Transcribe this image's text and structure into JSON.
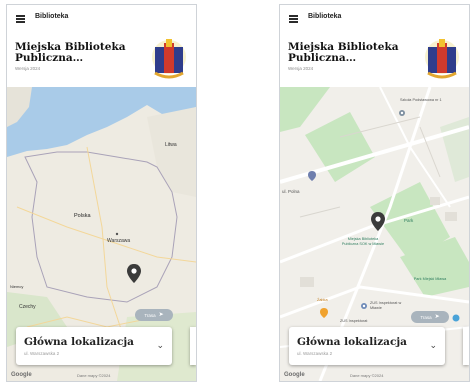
{
  "app": {
    "title": "Biblioteka",
    "library_name": "Miejska Biblioteka Publiczna…",
    "library_subtitle": "Wersja 2024"
  },
  "icons": {
    "menu": "hamburger-menu-icon",
    "logo": "library-books-logo-icon",
    "marker": "map-pin-icon",
    "chevron": "chevron-down-icon"
  },
  "left_screen": {
    "map_labels": {
      "country": "Polska",
      "city": "Warszawa",
      "neighbor_ne": "Litwa",
      "neighbor_sw": "Czechy",
      "neighbor_w": "Niemcy"
    },
    "pill_label": "Trasa"
  },
  "right_screen": {
    "map_labels": {
      "place_top": "Szkoła Podstawowa nr 1",
      "street_left": "ul. Polna",
      "park_top": "Park",
      "library_label": "Miejska Biblioteka Publiczna SOK w Mławie",
      "park_bottom": "Park Miejski Mława",
      "shop_label": "Żabka",
      "bottom_label_1": "ZUS Inspektorat w Mławie",
      "bottom_label_2": "ZUS Inspektorat"
    },
    "pill_label": "Trasa"
  },
  "location_card": {
    "title": "Główna lokalizacja",
    "subtitle": "ul. Warszawska 2",
    "chevron": "⌄"
  },
  "map_footer": {
    "brand": "Google",
    "terms": "Dane mapy ©2024"
  },
  "colors": {
    "water": "#a9cbe8",
    "land": "#eeebe2",
    "green": "#c8e6c0",
    "road": "#ffffff",
    "pin": "#3b3b3b",
    "pill": "#a9b4bd"
  }
}
